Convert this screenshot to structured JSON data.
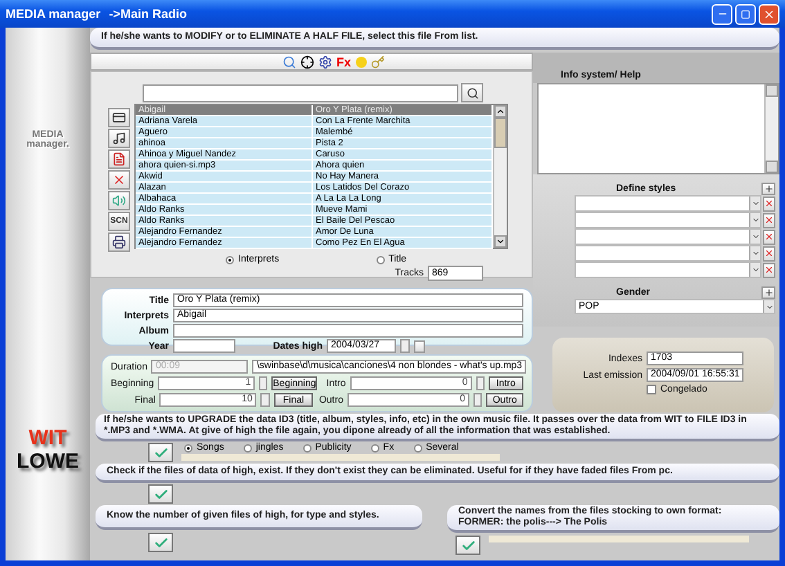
{
  "window": {
    "title": "MEDIA manager",
    "subtitle": "->Main Radio"
  },
  "sidebar": {
    "logo_top": "MEDIA manager.",
    "brand_red": "WIT",
    "brand_dark": "LOWE"
  },
  "top_banner": "If he/she wants to MODIFY or to ELIMINATE A HALF FILE, select this file From list.",
  "toolbar": {
    "fx_label": "Fx"
  },
  "list": {
    "side_buttons": [
      {
        "kind": "card"
      },
      {
        "kind": "note"
      },
      {
        "kind": "doc"
      },
      {
        "kind": "delete"
      },
      {
        "kind": "speaker"
      },
      {
        "kind": "text",
        "label": "SCN"
      },
      {
        "kind": "printer"
      }
    ],
    "rows": [
      {
        "interpret": "Abigail",
        "title": "Oro Y Plata (remix)",
        "selected": true
      },
      {
        "interpret": "Adriana Varela",
        "title": "Con La Frente Marchita",
        "selected": false
      },
      {
        "interpret": "Aguero",
        "title": " Malembé",
        "selected": false
      },
      {
        "interpret": "ahinoa",
        "title": "Pista 2",
        "selected": false
      },
      {
        "interpret": "Ahinoa y Miguel Nandez",
        "title": "Caruso",
        "selected": false
      },
      {
        "interpret": "ahora quien-si.mp3",
        "title": "Ahora quien",
        "selected": false
      },
      {
        "interpret": "Akwid",
        "title": "No Hay Manera",
        "selected": false
      },
      {
        "interpret": "Alazan",
        "title": " Los Latidos Del Corazo",
        "selected": false
      },
      {
        "interpret": "Albahaca",
        "title": " A La La La Long",
        "selected": false
      },
      {
        "interpret": "Aldo Ranks",
        "title": "Mueve Mami",
        "selected": false
      },
      {
        "interpret": "Aldo Ranks",
        "title": "El Baile Del Pescao",
        "selected": false
      },
      {
        "interpret": "Alejandro Fernandez",
        "title": "Amor De Luna",
        "selected": false
      },
      {
        "interpret": "Alejandro Fernandez",
        "title": "Como Pez En El Agua",
        "selected": false
      }
    ],
    "sort": [
      {
        "label": "Interprets",
        "selected": true
      },
      {
        "label": "Title",
        "selected": false
      }
    ],
    "tracks_label": "Tracks",
    "tracks_value": "869"
  },
  "details": {
    "title_label": "Title",
    "title_value": "Oro Y Plata (remix)",
    "interprets_label": "Interprets",
    "interprets_value": "Abigail",
    "album_label": "Album",
    "year_label": "Year",
    "dates_label": "Dates high",
    "dates_value": "2004/03/27"
  },
  "timing": {
    "duration_label": "Duration",
    "duration_value": "00:09",
    "path": "\\swinbase\\d\\musica\\canciones\\4 non blondes - what's up.mp3",
    "rows": [
      {
        "label": "Beginning",
        "value": "1",
        "button": "Beginning"
      },
      {
        "label": "Final",
        "value": "10",
        "button": "Final"
      }
    ],
    "rows_right": [
      {
        "label": "Intro",
        "value": "0",
        "button": "Intro"
      },
      {
        "label": "Outro",
        "value": "0",
        "button": "Outro"
      }
    ]
  },
  "info": {
    "label": "Info system/ Help"
  },
  "styles": {
    "label": "Define styles",
    "slots": [
      {
        "kind": "select"
      },
      {
        "kind": "select"
      },
      {
        "kind": "select"
      },
      {
        "kind": "select"
      },
      {
        "kind": "select"
      }
    ]
  },
  "gender": {
    "label": "Gender",
    "value": "POP"
  },
  "stats": {
    "indexes_label": "Indexes",
    "indexes_value": "1703",
    "emission_label": "Last emission",
    "emission_value": "2004/09/01  16:55:31",
    "frozen_label": "Congelado",
    "frozen_checked": false
  },
  "upgrade": {
    "text": "If he/she wants to UPGRADE the data ID3 (title, album, styles, info, etc) in the own music file. It passes over the data from WIT to FILE ID3 in *.MP3 and *.WMA. At give of high the file again, you dipone already of all the information that was established.",
    "types": [
      {
        "label": "Songs",
        "selected": true
      },
      {
        "label": "jingles",
        "selected": false
      },
      {
        "label": "Publicity",
        "selected": false
      },
      {
        "label": "Fx",
        "selected": false
      },
      {
        "label": "Several",
        "selected": false
      }
    ],
    "progress": {
      "level": 0
    }
  },
  "check_text": "Check if the files of data of high, exist. If they don't exist they can be eliminated. Useful for if they have faded files From pc.",
  "count_text": "Know the number of given files of high, for type and styles.",
  "convert_text": "Convert the names from the files stocking to own format:  FORMER:   the polis---> The Polis",
  "convert_progress": {
    "level": 0
  }
}
